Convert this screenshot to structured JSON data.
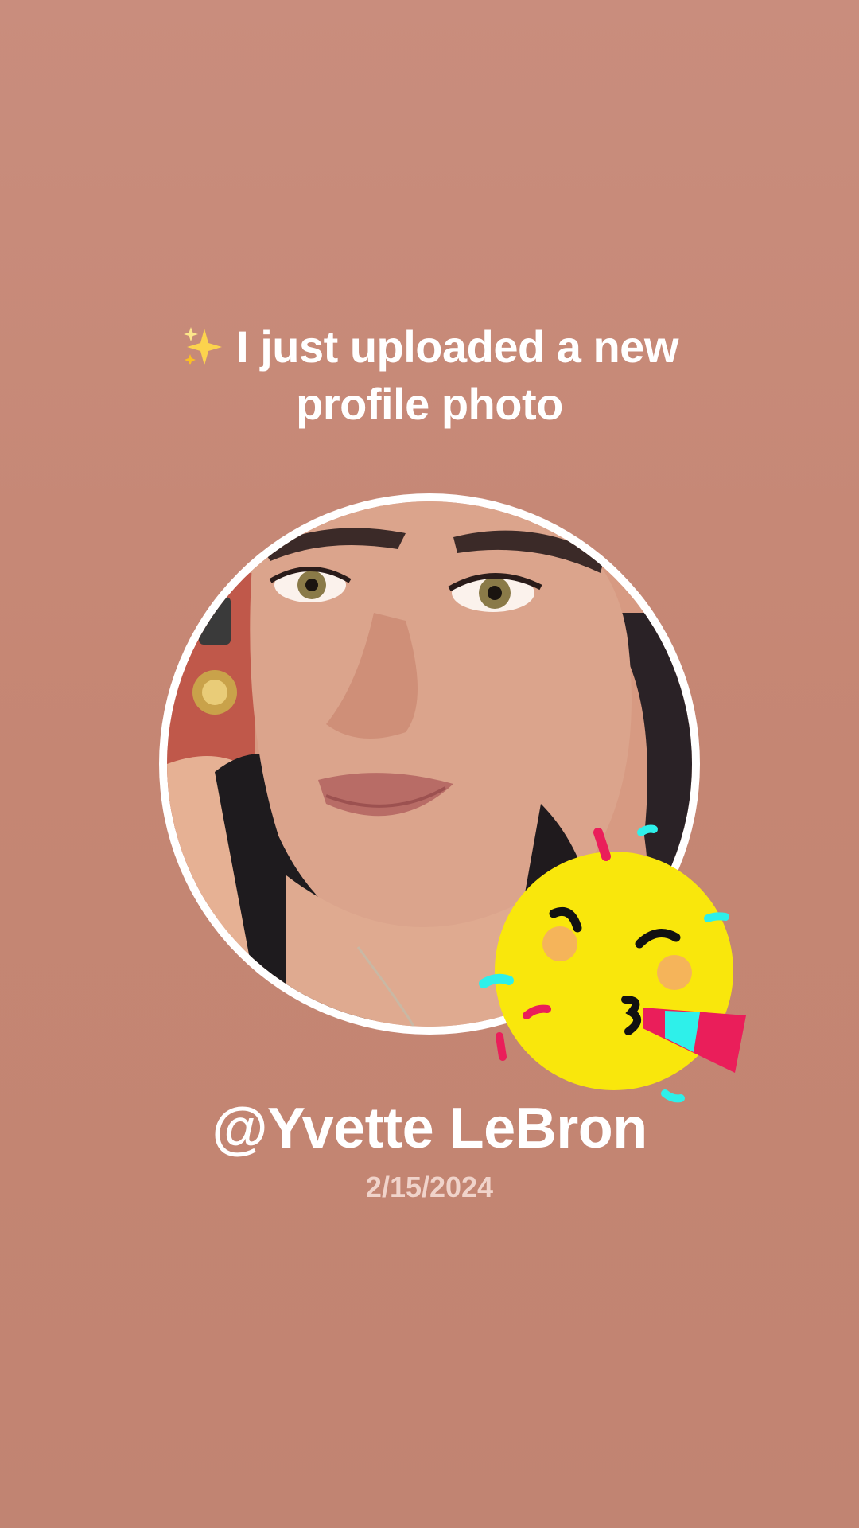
{
  "headline": {
    "text": "I just uploaded a new profile photo",
    "icon": "sparkles-icon"
  },
  "profile": {
    "username": "@Yvette LeBron",
    "date": "2/15/2024"
  },
  "sticker": {
    "icon": "party-face-icon"
  },
  "colors": {
    "background": "#c58673",
    "text": "#ffffff",
    "date_text": "#f0d3ca",
    "ring": "#ffffff",
    "sticker_face": "#f9e70c",
    "sticker_accent_pink": "#ea1e5a",
    "sticker_accent_cyan": "#2ef0ea"
  }
}
